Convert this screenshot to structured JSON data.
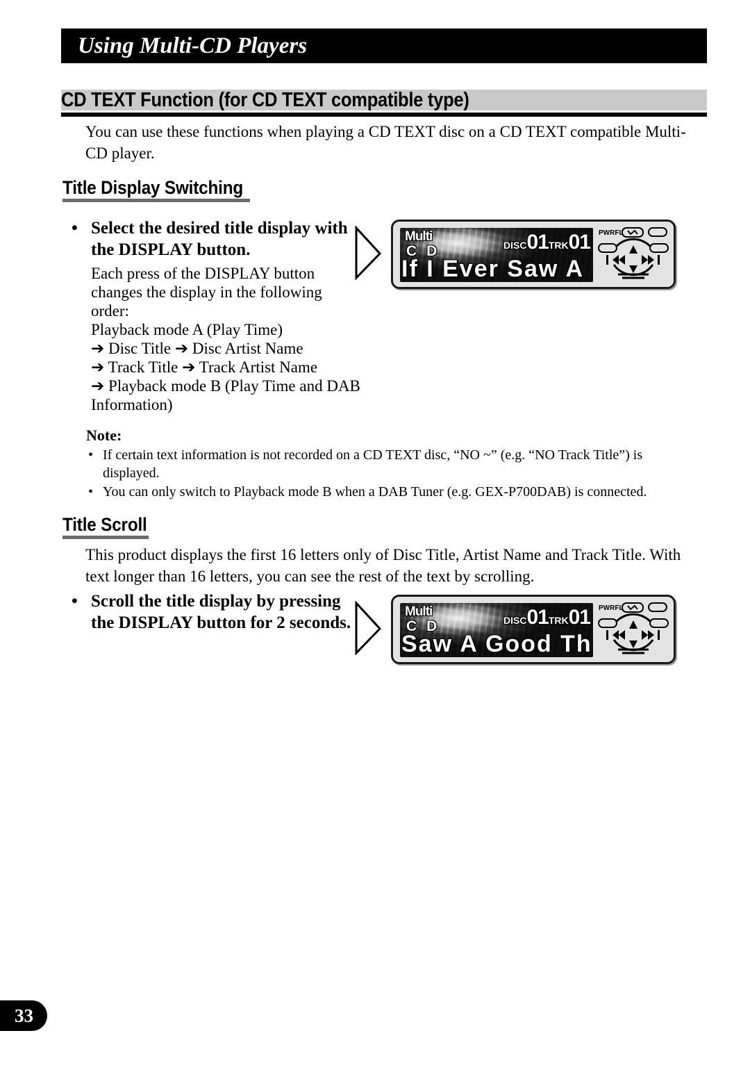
{
  "chapter": {
    "title": "Using Multi-CD Players"
  },
  "section": {
    "heading": "CD TEXT Function (for CD TEXT compatible type)",
    "intro": "You can use these functions when playing a CD TEXT disc on a CD TEXT compatible Multi-CD player."
  },
  "title_display_switching": {
    "heading": "Title Display Switching",
    "instruction": {
      "bullet": "•",
      "text": "Select the desired title display with the DISPLAY button."
    },
    "explanation": {
      "intro": "Each press of the DISPLAY button changes the display in the following order:",
      "steps": [
        "Playback mode A (Play Time)",
        "➔ Disc Title ➔ Disc Artist Name",
        "➔ Track Title ➔ Track Artist Name",
        "➔ Playback mode B (Play Time and DAB Information)"
      ]
    },
    "display": {
      "badge_top": "Multi",
      "badge_bottom": "CD",
      "disc_label": "DISC",
      "disc_value": "01",
      "track_label": "TRK",
      "track_value": "01",
      "text_line": "If I Ever Saw A",
      "power_label": "PWRFL",
      "prev_icon": "skip-back-icon",
      "next_icon": "skip-forward-icon",
      "up_icon": "up-arrow-icon",
      "down_icon": "down-arrow-icon"
    }
  },
  "note": {
    "title": "Note:",
    "items": [
      "If certain text information is not recorded on a CD TEXT disc, “NO ~” (e.g. “NO Track Title”) is displayed.",
      "You can only switch to Playback mode B when a DAB Tuner (e.g. GEX-P700DAB) is connected."
    ],
    "bullet": "•"
  },
  "title_scroll": {
    "heading": "Title Scroll",
    "paragraph": "This product displays the first 16 letters only of Disc Title, Artist Name and Track Title. With text longer than 16 letters, you can see the rest of the text by scrolling.",
    "instruction": {
      "bullet": "•",
      "text": "Scroll the title display by pressing the DISPLAY button for 2 seconds."
    },
    "display": {
      "badge_top": "Multi",
      "badge_bottom": "CD",
      "disc_label": "DISC",
      "disc_value": "01",
      "track_label": "TRK",
      "track_value": "01",
      "text_line": "Saw A Good Thin",
      "power_label": "PWRFL",
      "prev_icon": "skip-back-icon",
      "next_icon": "skip-forward-icon",
      "up_icon": "up-arrow-icon",
      "down_icon": "down-arrow-icon"
    }
  },
  "footer": {
    "page_number": "33"
  },
  "colors": {
    "band": "#000000",
    "heading_bar": "#c9c9c9",
    "sub_rule": "#6b6b6b",
    "unit_body": "#e3e3e3"
  }
}
